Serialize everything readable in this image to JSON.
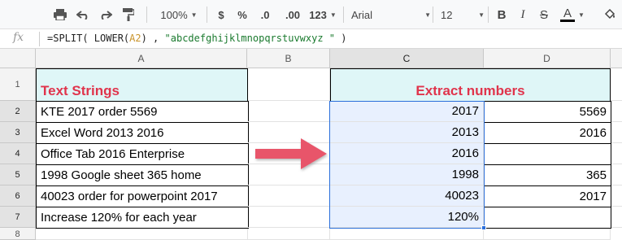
{
  "toolbar": {
    "zoom": "100%",
    "currency": "$",
    "percent": "%",
    "decrease_decimals": ".0",
    "increase_decimals": ".00",
    "more_formats": "123",
    "font": "Arial",
    "font_size": "12",
    "bold": "B",
    "italic": "I",
    "strikethrough": "S",
    "text_color": "A",
    "icons": [
      "print-icon",
      "undo-icon",
      "redo-icon",
      "paint-format-icon",
      "fill-color-icon"
    ]
  },
  "formula_bar": {
    "fx": "fx",
    "formula_prefix": "=SPLIT( LOWER(",
    "formula_ref": "A2",
    "formula_mid": ") , ",
    "formula_string": "\"abcdefghijklmnopqrstuvwxyz \"",
    "formula_suffix": " )"
  },
  "columns": [
    "A",
    "B",
    "C",
    "D"
  ],
  "rows": [
    "1",
    "2",
    "3",
    "4",
    "5",
    "6",
    "7",
    "8"
  ],
  "header_row": {
    "a1": "Text Strings",
    "cd1": "Extract numbers"
  },
  "data_rows": [
    {
      "a": "KTE 2017 order 5569",
      "c": "2017",
      "d": "5569"
    },
    {
      "a": "Excel Word 2013 2016",
      "c": "2013",
      "d": "2016"
    },
    {
      "a": "Office Tab 2016 Enterprise",
      "c": "2016",
      "d": ""
    },
    {
      "a": "1998 Google sheet 365 home",
      "c": "1998",
      "d": "365"
    },
    {
      "a": "40023 order for powerpoint 2017",
      "c": "40023",
      "d": "2017"
    },
    {
      "a": "Increase 120% for each year",
      "c": "120%",
      "d": ""
    }
  ],
  "colors": {
    "header_text": "#e0344c",
    "header_fill": "#dff6f7",
    "arrow": "#e8556b",
    "selection": "#2a6fdb"
  }
}
